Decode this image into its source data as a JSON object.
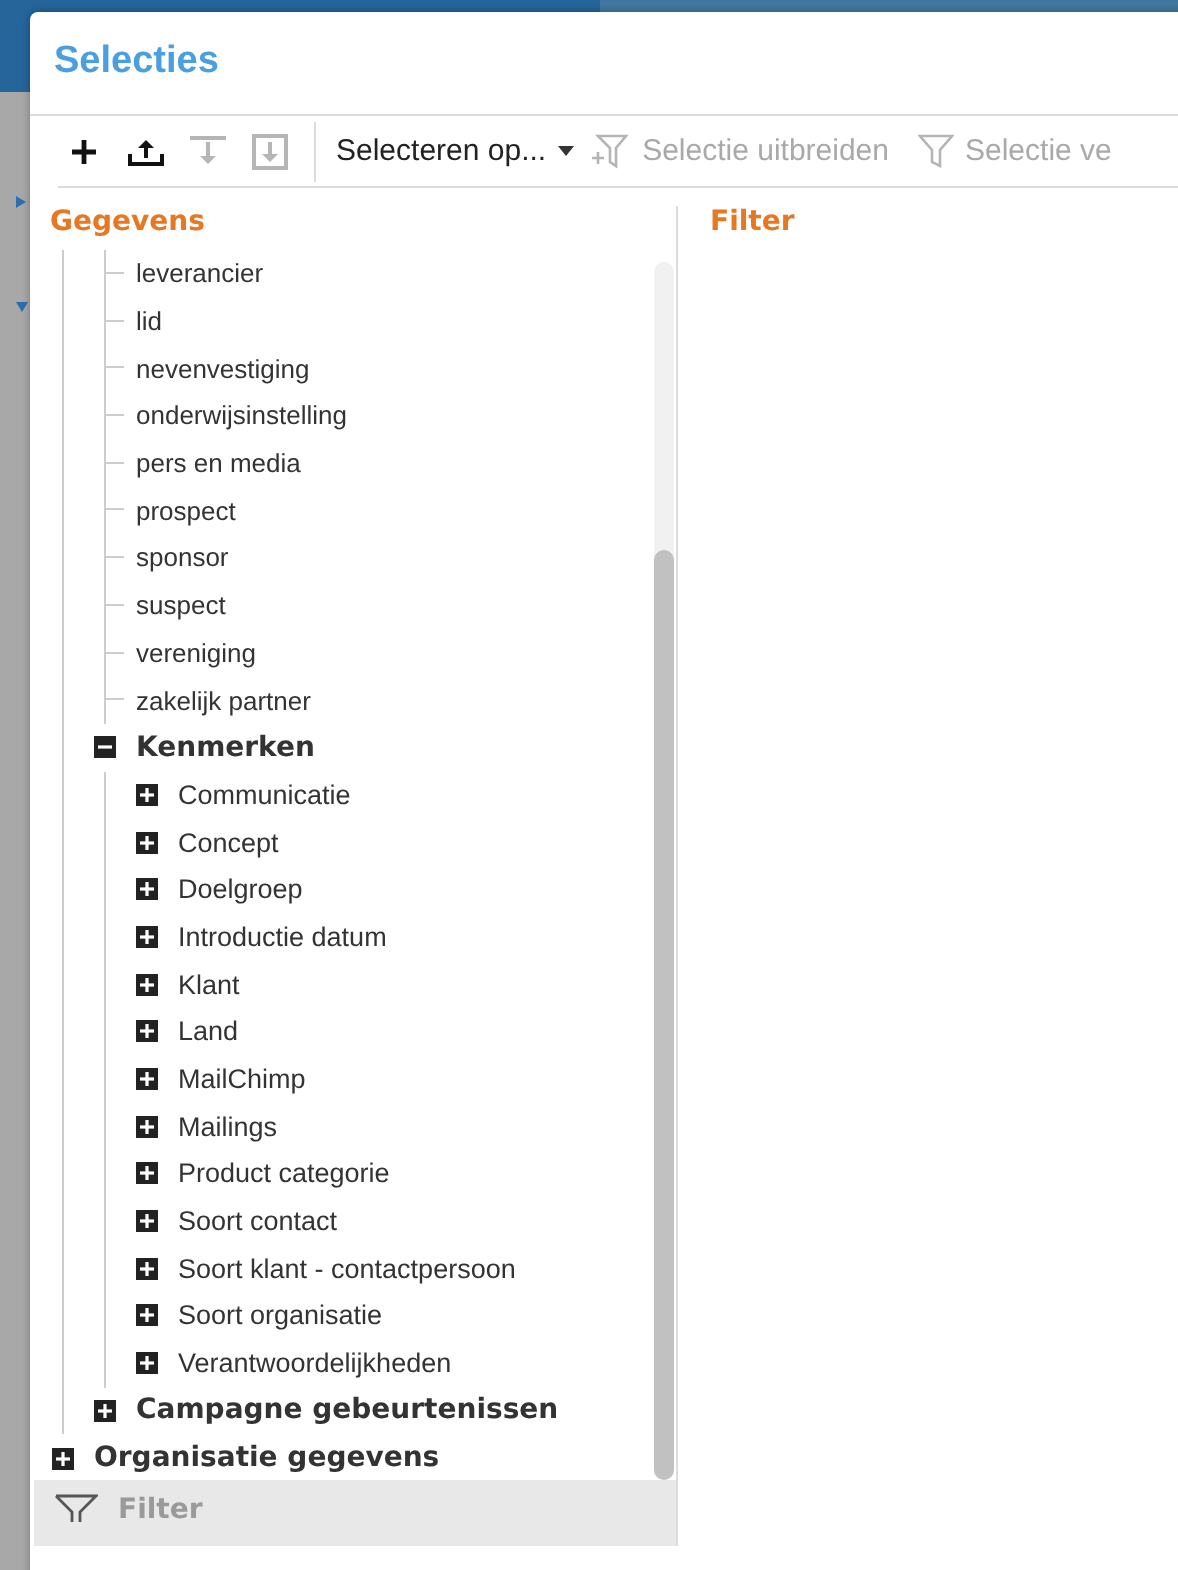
{
  "window": {
    "title": "Selecties"
  },
  "toolbar": {
    "icon_buttons": [
      {
        "kind": "add",
        "disabled": false
      },
      {
        "kind": "upload",
        "disabled": false
      },
      {
        "kind": "download",
        "disabled": true
      },
      {
        "kind": "import",
        "disabled": true
      }
    ],
    "dropdown": {
      "label": "Selecteren op..."
    },
    "actions": [
      {
        "kind": "filter-add",
        "label": "Selectie uitbreiden",
        "disabled": true
      },
      {
        "kind": "filter",
        "label": "Selectie ve",
        "disabled": true
      }
    ]
  },
  "left_panel": {
    "heading": "Gegevens",
    "footer": "Filter",
    "tree": [
      {
        "kind": "group",
        "children": [
          {
            "kind": "group",
            "children": [
              {
                "label": "leverancier"
              },
              {
                "label": "lid"
              },
              {
                "label": "nevenvestiging"
              },
              {
                "label": "onderwijsinstelling"
              },
              {
                "label": "pers en media"
              },
              {
                "label": "prospect"
              },
              {
                "label": "sponsor"
              },
              {
                "label": "suspect"
              },
              {
                "label": "vereniging"
              },
              {
                "label": "zakelijk partner"
              }
            ]
          },
          {
            "label": "Kenmerken",
            "expanded": true,
            "children": [
              {
                "label": "Communicatie",
                "expanded": false
              },
              {
                "label": "Concept",
                "expanded": false
              },
              {
                "label": "Doelgroep",
                "expanded": false
              },
              {
                "label": "Introductie datum",
                "expanded": false
              },
              {
                "label": "Klant",
                "expanded": false
              },
              {
                "label": "Land",
                "expanded": false
              },
              {
                "label": "MailChimp",
                "expanded": false
              },
              {
                "label": "Mailings",
                "expanded": false
              },
              {
                "label": "Product categorie",
                "expanded": false
              },
              {
                "label": "Soort contact",
                "expanded": false
              },
              {
                "label": "Soort klant - contactpersoon",
                "expanded": false
              },
              {
                "label": "Soort organisatie",
                "expanded": false
              },
              {
                "label": "Verantwoordelijkheden",
                "expanded": false
              }
            ]
          },
          {
            "label": "Campagne gebeurtenissen",
            "expanded": false
          }
        ]
      },
      {
        "label": "Organisatie gegevens",
        "expanded": false
      }
    ]
  },
  "right_panel": {
    "heading": "Filter"
  }
}
